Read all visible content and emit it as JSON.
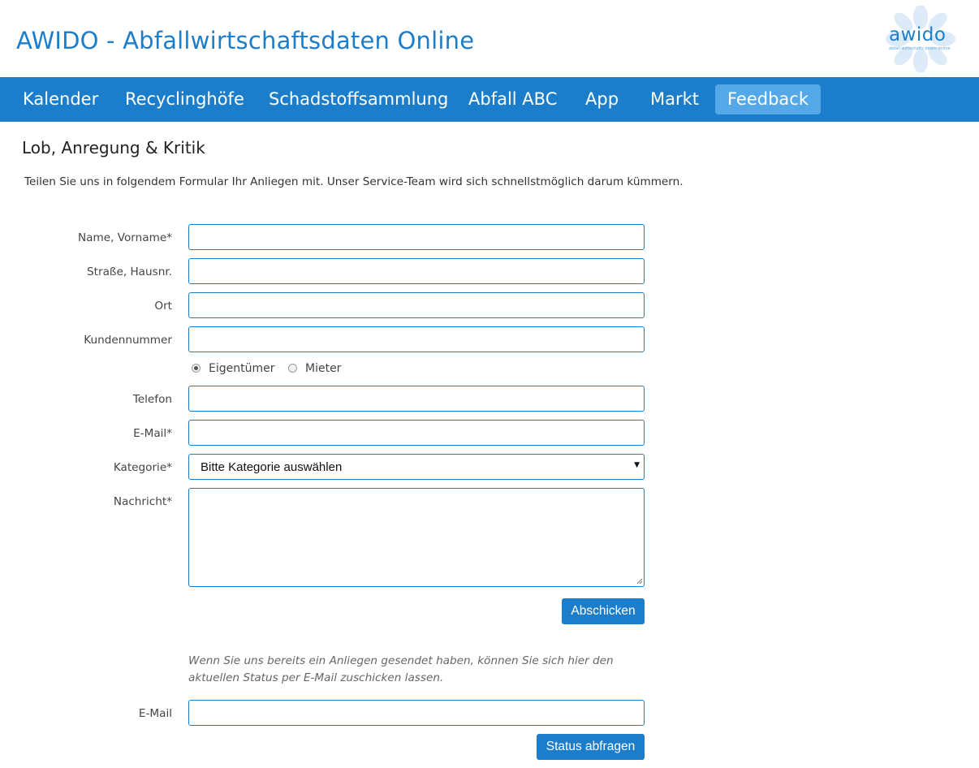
{
  "header": {
    "title": "AWIDO - Abfallwirtschaftsdaten Online",
    "logo": {
      "text": "awido",
      "tagline": "abfall wirtschafts daten online",
      "icon": "flower-logo-icon"
    }
  },
  "nav": {
    "items": [
      {
        "label": "Kalender"
      },
      {
        "label": "Recyclinghöfe"
      },
      {
        "label": "Schadstoffsammlung"
      },
      {
        "label": "Abfall ABC"
      },
      {
        "label": "App"
      },
      {
        "label": "Markt"
      },
      {
        "label": "Feedback",
        "active": true
      }
    ]
  },
  "page": {
    "heading": "Lob, Anregung & Kritik",
    "intro": "Teilen Sie uns in folgendem Formular Ihr Anliegen mit. Unser Service-Team wird sich schnellstmöglich darum kümmern."
  },
  "form": {
    "name_label": "Name, Vorname*",
    "name_value": "",
    "street_label": "Straße, Hausnr.",
    "street_value": "",
    "city_label": "Ort",
    "city_value": "",
    "customer_label": "Kundennummer",
    "customer_value": "",
    "owner_options": [
      {
        "label": "Eigentümer",
        "checked": true
      },
      {
        "label": "Mieter",
        "checked": false
      }
    ],
    "phone_label": "Telefon",
    "phone_value": "",
    "email_label": "E-Mail*",
    "email_value": "",
    "category_label": "Kategorie*",
    "category_value": "Bitte Kategorie auswählen",
    "message_label": "Nachricht*",
    "message_value": "",
    "submit_label": "Abschicken"
  },
  "status": {
    "note": "Wenn Sie uns bereits ein Anliegen gesendet haben, können Sie sich hier den aktuellen Status per E-Mail zuschicken lassen.",
    "email_label": "E-Mail",
    "email_value": "",
    "button_label": "Status abfragen"
  },
  "colors": {
    "brand_blue": "#1c7ecb",
    "nav_active": "#55a8e8",
    "logo_petals": "#dcebf7"
  }
}
